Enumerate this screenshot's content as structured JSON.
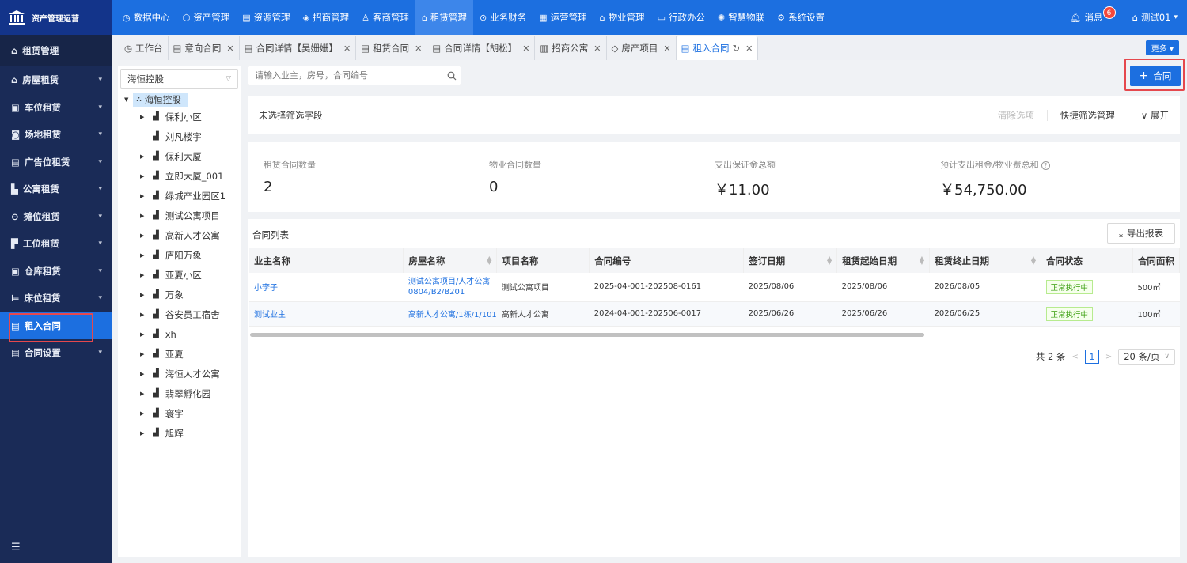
{
  "app": {
    "title": "资产管理运营"
  },
  "topnav": [
    {
      "label": "数据中心",
      "icon": "clock-icon"
    },
    {
      "label": "资产管理",
      "icon": "cube-icon"
    },
    {
      "label": "资源管理",
      "icon": "document-icon"
    },
    {
      "label": "招商管理",
      "icon": "tag-icon"
    },
    {
      "label": "客商管理",
      "icon": "users-icon"
    },
    {
      "label": "租赁管理",
      "icon": "home-icon",
      "active": true
    },
    {
      "label": "业务财务",
      "icon": "yuan-icon"
    },
    {
      "label": "运营管理",
      "icon": "chart-icon"
    },
    {
      "label": "物业管理",
      "icon": "building-icon"
    },
    {
      "label": "行政办公",
      "icon": "monitor-icon"
    },
    {
      "label": "智慧物联",
      "icon": "iot-icon"
    },
    {
      "label": "系统设置",
      "icon": "gear-icon"
    }
  ],
  "topright": {
    "messages_label": "消息",
    "messages_count": "6",
    "user_name": "测试01"
  },
  "sidebar": {
    "header": "租赁管理",
    "items": [
      {
        "label": "房屋租赁"
      },
      {
        "label": "车位租赁"
      },
      {
        "label": "场地租赁"
      },
      {
        "label": "广告位租赁"
      },
      {
        "label": "公寓租赁"
      },
      {
        "label": "摊位租赁"
      },
      {
        "label": "工位租赁"
      },
      {
        "label": "仓库租赁"
      },
      {
        "label": "床位租赁"
      },
      {
        "label": "租入合同",
        "active": true
      },
      {
        "label": "合同设置"
      }
    ]
  },
  "tabs": [
    {
      "label": "工作台",
      "closable": false
    },
    {
      "label": "意向合同",
      "closable": true
    },
    {
      "label": "合同详情【吴姗姗】",
      "closable": true
    },
    {
      "label": "租赁合同",
      "closable": true
    },
    {
      "label": "合同详情【胡松】",
      "closable": true
    },
    {
      "label": "招商公寓",
      "closable": true
    },
    {
      "label": "房产项目",
      "closable": true
    },
    {
      "label": "租入合同",
      "closable": true,
      "active": true
    }
  ],
  "tabs_more": "更多",
  "tree": {
    "selected": "海恒控股",
    "root": "海恒控股",
    "nodes": [
      "保利小区",
      "刘凡楼宇",
      "保利大厦",
      "立即大厦_001",
      "绿城产业园区1",
      "测试公寓项目",
      "高新人才公寓",
      "庐阳万象",
      "亚夏小区",
      "万象",
      "谷安员工宿舍",
      "xh",
      "亚夏",
      "海恒人才公寓",
      "翡翠孵化园",
      "寰宇",
      "旭辉"
    ]
  },
  "search": {
    "placeholder": "请输入业主，房号，合同编号"
  },
  "add_button": "合同",
  "filter": {
    "text": "未选择筛选字段",
    "clear": "清除选项",
    "manage": "快捷筛选管理",
    "expand": "展开"
  },
  "stats": [
    {
      "label": "租赁合同数量",
      "value": "2"
    },
    {
      "label": "物业合同数量",
      "value": "0"
    },
    {
      "label": "支出保证金总额",
      "value": "￥11.00"
    },
    {
      "label": "预计支出租金/物业费总和",
      "value": "￥54,750.00"
    }
  ],
  "table": {
    "title": "合同列表",
    "export": "导出报表",
    "columns": [
      "业主名称",
      "房屋名称",
      "项目名称",
      "合同编号",
      "签订日期",
      "租赁起始日期",
      "租赁终止日期",
      "合同状态",
      "合同面积"
    ],
    "rows": [
      {
        "owner": "小李子",
        "house": "测试公寓项目/人才公寓0804/B2/B201",
        "project": "测试公寓项目",
        "contract_no": "2025-04-001-202508-0161",
        "sign_date": "2025/08/06",
        "start": "2025/08/06",
        "end": "2026/08/05",
        "status": "正常执行中",
        "area": "500㎡"
      },
      {
        "owner": "测试业主",
        "house": "高新人才公寓/1栋/1/101",
        "project": "高新人才公寓",
        "contract_no": "2024-04-001-202506-0017",
        "sign_date": "2025/06/26",
        "start": "2025/06/26",
        "end": "2026/06/25",
        "status": "正常执行中",
        "area": "100㎡"
      }
    ]
  },
  "pager": {
    "total": "共 2 条",
    "page": "1",
    "size": "20 条/页"
  }
}
